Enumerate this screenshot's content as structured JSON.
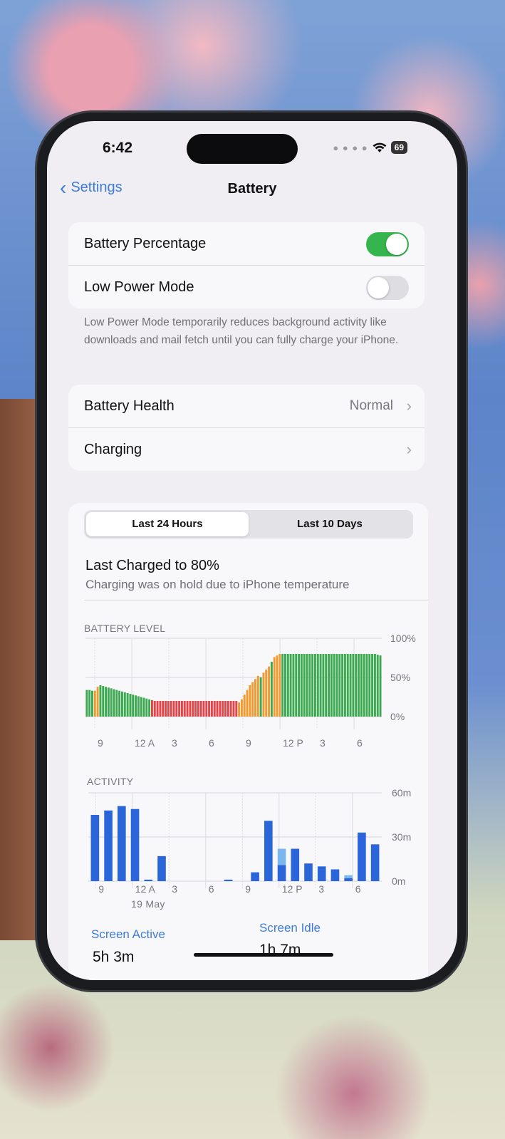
{
  "status": {
    "time": "6:42",
    "battery": "69"
  },
  "nav": {
    "back_label": "Settings",
    "title": "Battery"
  },
  "settings": {
    "battery_percentage_label": "Battery Percentage",
    "battery_percentage_on": true,
    "low_power_label": "Low Power Mode",
    "low_power_on": false,
    "low_power_footnote": "Low Power Mode temporarily reduces background activity like downloads and mail fetch until you can fully charge your iPhone.",
    "battery_health_label": "Battery Health",
    "battery_health_value": "Normal",
    "charging_label": "Charging"
  },
  "usage": {
    "tabs": [
      "Last 24 Hours",
      "Last 10 Days"
    ],
    "selected_tab": 0,
    "last_charged_title": "Last Charged to 80%",
    "last_charged_note": "Charging was on hold due to iPhone temperature",
    "battery_level_title": "BATTERY LEVEL",
    "activity_title": "ACTIVITY",
    "date_label": "19 May",
    "legend": [
      {
        "label": "Screen Active",
        "value": "5h 3m"
      },
      {
        "label": "Screen Idle",
        "value": "1h 7m"
      }
    ]
  },
  "colors": {
    "accent": "#3d7bd8",
    "toggle_on": "#35b54e",
    "bar_green": "#3aa94f",
    "bar_orange": "#f09a30",
    "bar_red": "#e0464a",
    "bar_blue_dark": "#2a66d9",
    "bar_blue_light": "#7bb6ec"
  },
  "chart_data": [
    {
      "type": "bar",
      "title": "BATTERY LEVEL",
      "x_ticks": [
        "9",
        "12 A",
        "3",
        "6",
        "9",
        "12 P",
        "3",
        "6"
      ],
      "y_ticks": [
        "100%",
        "50%",
        "0%"
      ],
      "ylim": [
        0,
        100
      ],
      "values": [
        34,
        34,
        33,
        33,
        38,
        40,
        39,
        38,
        37,
        36,
        35,
        34,
        33,
        32,
        31,
        30,
        29,
        28,
        27,
        26,
        25,
        24,
        23,
        22,
        21,
        20,
        20,
        20,
        20,
        20,
        20,
        20,
        20,
        20,
        20,
        20,
        20,
        20,
        20,
        20,
        20,
        20,
        20,
        20,
        20,
        20,
        20,
        20,
        20,
        20,
        20,
        20,
        20,
        20,
        20,
        20,
        18,
        22,
        28,
        34,
        40,
        44,
        48,
        52,
        50,
        56,
        60,
        64,
        70,
        76,
        78,
        80,
        80,
        80,
        80,
        80,
        80,
        80,
        80,
        80,
        80,
        80,
        80,
        80,
        80,
        80,
        80,
        80,
        80,
        80,
        80,
        80,
        80,
        80,
        80,
        80,
        80,
        80,
        80,
        80,
        80,
        80,
        80,
        80,
        80,
        80,
        80,
        79,
        78
      ],
      "series_state": [
        "green",
        "green",
        "green",
        "orange",
        "orange",
        "green",
        "green",
        "green",
        "green",
        "green",
        "green",
        "green",
        "green",
        "green",
        "green",
        "green",
        "green",
        "green",
        "green",
        "green",
        "green",
        "green",
        "green",
        "green",
        "red",
        "red",
        "red",
        "red",
        "red",
        "red",
        "red",
        "red",
        "red",
        "red",
        "red",
        "red",
        "red",
        "red",
        "red",
        "red",
        "red",
        "red",
        "red",
        "red",
        "red",
        "red",
        "red",
        "red",
        "red",
        "red",
        "red",
        "red",
        "red",
        "red",
        "red",
        "red",
        "orange",
        "orange",
        "orange",
        "orange",
        "orange",
        "orange",
        "orange",
        "orange",
        "green",
        "orange",
        "orange",
        "orange",
        "green",
        "orange",
        "orange",
        "orange",
        "green",
        "green",
        "green",
        "green",
        "green",
        "green",
        "green",
        "green",
        "green",
        "green",
        "green",
        "green",
        "green",
        "green",
        "green",
        "green",
        "green",
        "green",
        "green",
        "green",
        "green",
        "green",
        "green",
        "green",
        "green",
        "green",
        "green",
        "green",
        "green",
        "green",
        "green",
        "green",
        "green",
        "green",
        "green",
        "green",
        "green"
      ]
    },
    {
      "type": "bar",
      "title": "ACTIVITY",
      "x_ticks": [
        "9",
        "12 A",
        "3",
        "6",
        "9",
        "12 P",
        "3",
        "6"
      ],
      "y_ticks": [
        "60m",
        "30m",
        "0m"
      ],
      "ylim": [
        0,
        60
      ],
      "series": [
        {
          "values": [
            45,
            48,
            51,
            49,
            1,
            17,
            0,
            0,
            0,
            0,
            1,
            0,
            6,
            41,
            11,
            22,
            12,
            10,
            8,
            2,
            33,
            25
          ]
        },
        {
          "values": [
            0,
            0,
            0,
            0,
            0,
            0,
            0,
            0,
            0,
            0,
            0,
            0,
            0,
            0,
            11,
            0,
            0,
            0,
            0,
            2,
            0,
            0
          ]
        }
      ]
    }
  ]
}
